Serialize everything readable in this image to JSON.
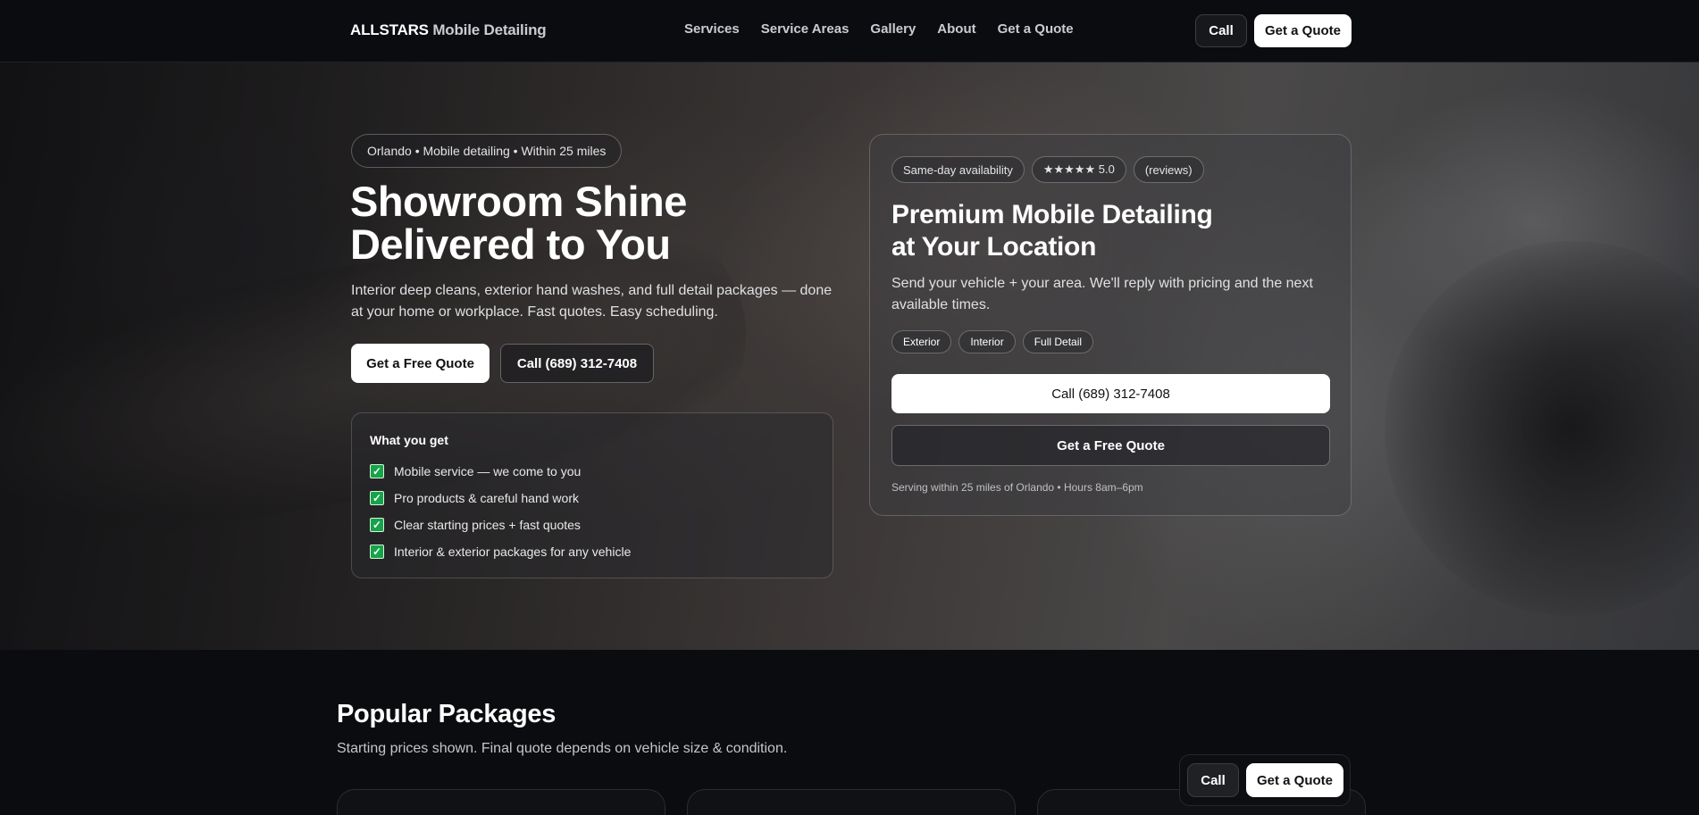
{
  "nav": {
    "brand_strong": "ALLSTARS",
    "brand_rest": " Mobile Detailing",
    "links": [
      "Services",
      "Service Areas",
      "Gallery",
      "About",
      "Get a Quote"
    ],
    "call_label": "Call",
    "quote_label": "Get a Quote"
  },
  "hero": {
    "location_pill": "Orlando • Mobile detailing • Within 25 miles",
    "title_line1": "Showroom Shine",
    "title_line2": "Delivered to You",
    "subtitle": "Interior deep cleans, exterior hand washes, and full detail packages — done at your home or workplace. Fast quotes. Easy scheduling.",
    "free_quote_label": "Get a Free Quote",
    "call_label": "Call (689) 312-7408",
    "benefits": {
      "title": "What you get",
      "items": [
        "Mobile service — we come to you",
        "Pro products & careful hand work",
        "Clear starting prices + fast quotes",
        "Interior & exterior packages for any vehicle"
      ],
      "check_glyph": "✓"
    }
  },
  "quote_card": {
    "chips": [
      "Same-day availability",
      "★★★★★ 5.0",
      "(reviews)"
    ],
    "title_line1": "Premium Mobile Detailing",
    "title_line2": "at Your Location",
    "subtitle": "Send your vehicle + your area. We'll reply with pricing and the next available times.",
    "services": [
      "Exterior",
      "Interior",
      "Full Detail"
    ],
    "call_label": "Call (689) 312-7408",
    "quote_label": "Get a Free Quote",
    "footer": "Serving within 25 miles of Orlando • Hours 8am–6pm"
  },
  "packages": {
    "title": "Popular Packages",
    "subtitle": "Starting prices shown. Final quote depends on vehicle size & condition."
  },
  "floating_bar": {
    "call_label": "Call",
    "quote_label": "Get a Quote"
  },
  "colors": {
    "background": "#0b0c0f",
    "check_green": "#16a34a",
    "button_white": "#ffffff"
  }
}
